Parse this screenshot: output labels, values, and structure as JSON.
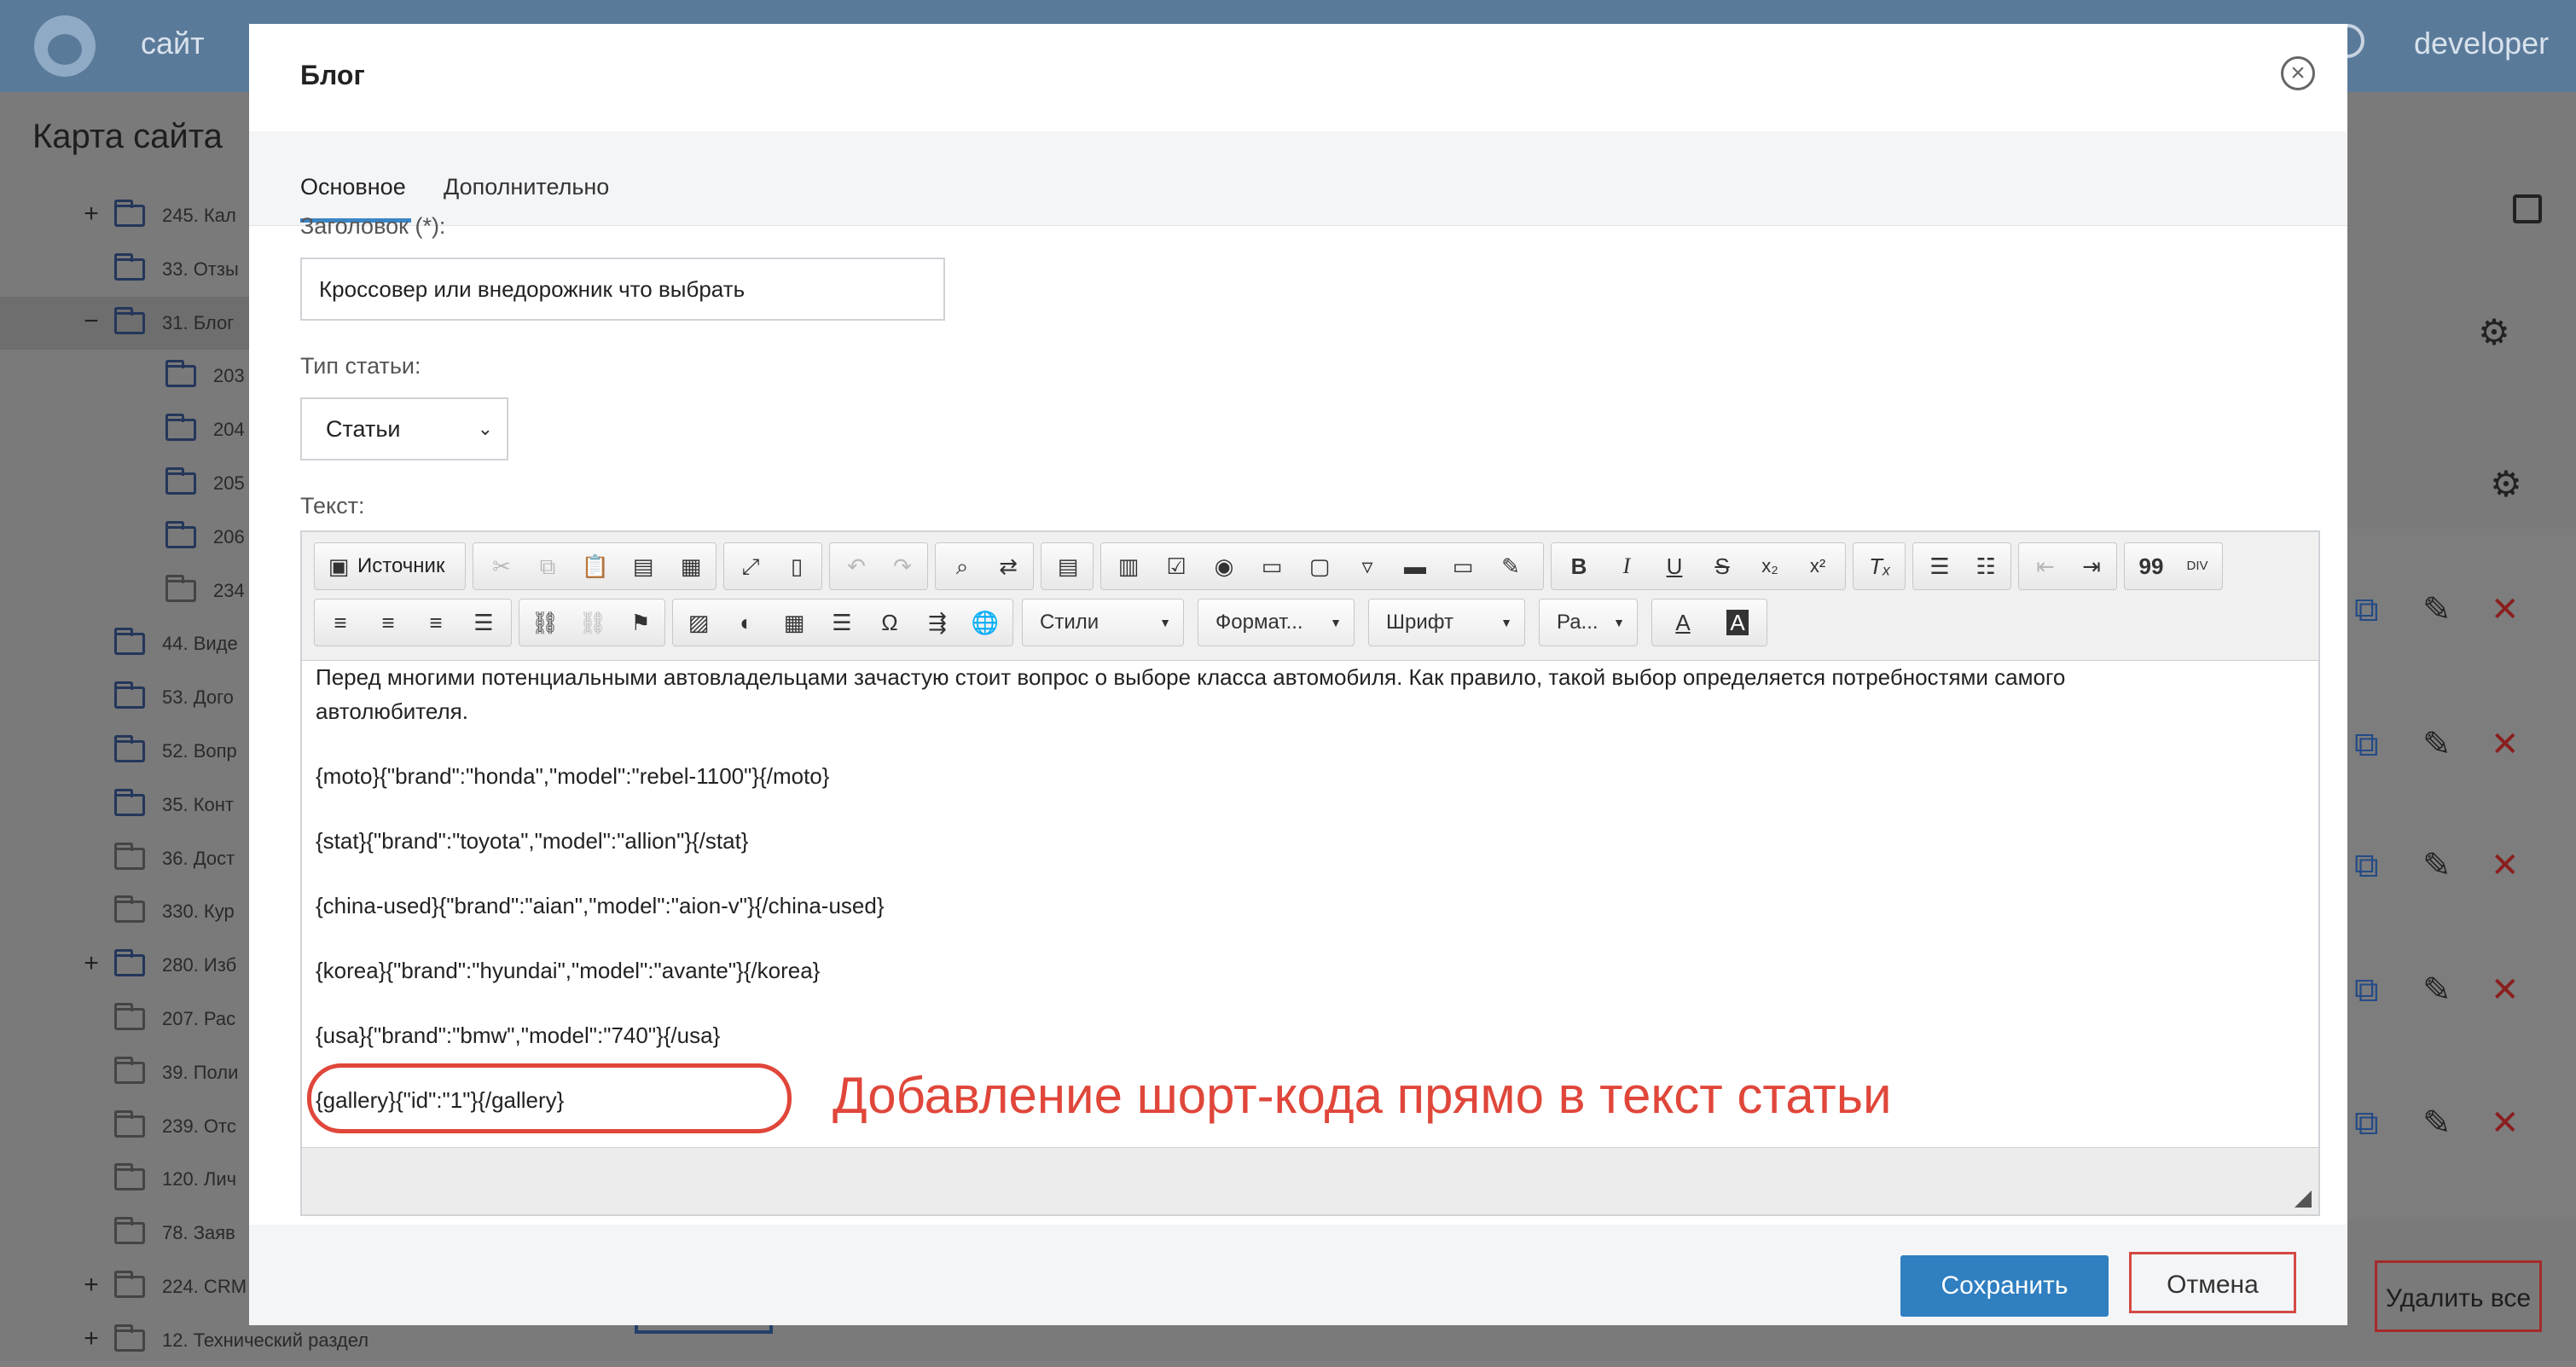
{
  "topbar": {
    "site_label": "сайт",
    "user_name": "developer"
  },
  "sidebar": {
    "title": "Карта сайта",
    "items": [
      {
        "toggle": "+",
        "label": "245. Кал"
      },
      {
        "toggle": "",
        "label": "33. Отзы"
      },
      {
        "toggle": "−",
        "label": "31. Блог"
      },
      {
        "toggle": "",
        "label": "203"
      },
      {
        "toggle": "",
        "label": "204"
      },
      {
        "toggle": "",
        "label": "205"
      },
      {
        "toggle": "",
        "label": "206"
      },
      {
        "toggle": "",
        "label": "234"
      },
      {
        "toggle": "",
        "label": "44. Виде"
      },
      {
        "toggle": "",
        "label": "53. Дого"
      },
      {
        "toggle": "",
        "label": "52. Вопр"
      },
      {
        "toggle": "",
        "label": "35. Конт"
      },
      {
        "toggle": "",
        "label": "36. Дост"
      },
      {
        "toggle": "",
        "label": "330. Кур"
      },
      {
        "toggle": "+",
        "label": "280. Изб"
      },
      {
        "toggle": "",
        "label": "207. Рас"
      },
      {
        "toggle": "",
        "label": "39. Поли"
      },
      {
        "toggle": "",
        "label": "239. Отс"
      },
      {
        "toggle": "",
        "label": "120. Лич"
      },
      {
        "toggle": "",
        "label": "78. Заяв"
      },
      {
        "toggle": "+",
        "label": "224. CRM"
      },
      {
        "toggle": "+",
        "label": "12. Технический раздел"
      }
    ]
  },
  "background": {
    "delete_all_label": "Удалить все"
  },
  "modal": {
    "title": "Блог",
    "tabs": [
      {
        "label": "Основное"
      },
      {
        "label": "Дополнительно"
      }
    ],
    "title_field": {
      "label": "Заголовок (*):",
      "value": "Кроссовер или внедорожник что выбрать"
    },
    "type_field": {
      "label": "Тип статьи:",
      "value": "Статьи"
    },
    "text_field": {
      "label": "Текст:"
    },
    "toolbar": {
      "source_label": "Источник",
      "styles_label": "Стили",
      "format_label": "Формат...",
      "font_label": "Шрифт",
      "size_label": "Ра...",
      "text_color_label": "A",
      "bg_color_label": "A",
      "bold": "B",
      "italic": "I",
      "underline": "U",
      "strike": "S",
      "subscript": "x₂",
      "superscript": "x²",
      "omega": "Ω",
      "quote": "99",
      "div": "DIV"
    },
    "editor": {
      "lines": [
        "Перед многими потенциальными автовладельцами зачастую стоит вопрос о выборе класса автомобиля. Как правило, такой выбор определяется потребностями самого",
        "автолюбителя.",
        "{moto}{\"brand\":\"honda\",\"model\":\"rebel-1100\"}{/moto}",
        "{stat}{\"brand\":\"toyota\",\"model\":\"allion\"}{/stat}",
        "{china-used}{\"brand\":\"aian\",\"model\":\"aion-v\"}{/china-used}",
        "{korea}{\"brand\":\"hyundai\",\"model\":\"avante\"}{/korea}",
        "{usa}{\"brand\":\"bmw\",\"model\":\"740\"}{/usa}",
        "{gallery}{\"id\":\"1\"}{/gallery}"
      ]
    },
    "annotation": "Добавление шорт-кода прямо в текст статьи",
    "footer": {
      "save_label": "Сохранить",
      "cancel_label": "Отмена"
    }
  },
  "colors": {
    "accent": "#2f7fc1",
    "annotation": "#e0463a",
    "header_bg": "#5a7a9a"
  }
}
